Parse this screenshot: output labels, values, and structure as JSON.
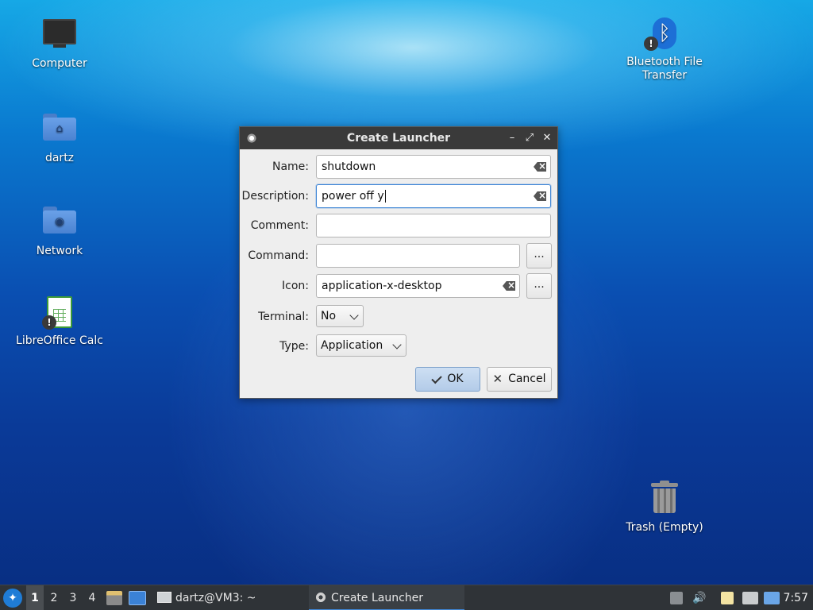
{
  "desktop": {
    "icons": [
      {
        "label": "Computer",
        "icon": "computer-icon"
      },
      {
        "label": "dartz",
        "icon": "home-folder-icon"
      },
      {
        "label": "Network",
        "icon": "network-folder-icon"
      },
      {
        "label": "LibreOffice Calc",
        "icon": "spreadsheet-icon"
      },
      {
        "label": "Bluetooth File Transfer",
        "icon": "bluetooth-icon"
      },
      {
        "label": "Trash (Empty)",
        "icon": "trash-icon"
      }
    ],
    "home_glyph": "⌂",
    "network_glyph": "◉",
    "warn_glyph": "!",
    "bluetooth_glyph": "ᛒ"
  },
  "dialog": {
    "title": "Create Launcher",
    "controls": {
      "minimize": "–",
      "maximize": "⤢",
      "close": "✕"
    },
    "labels": {
      "name": "Name:",
      "description": "Description:",
      "comment": "Comment:",
      "command": "Command:",
      "icon": "Icon:",
      "terminal": "Terminal:",
      "type": "Type:"
    },
    "values": {
      "name": "shutdown",
      "description": "power off y",
      "comment": "",
      "command": "",
      "icon": "application-x-desktop",
      "terminal": "No",
      "type": "Application"
    },
    "browse_label": "...",
    "ok_label": "OK",
    "cancel_label": "Cancel",
    "cancel_glyph": "✕"
  },
  "taskbar": {
    "start_glyph": "✦",
    "workspaces": [
      "1",
      "2",
      "3",
      "4"
    ],
    "active_workspace": "1",
    "tasks": [
      {
        "label": "dartz@VM3: ~",
        "active": false
      },
      {
        "label": "Create Launcher",
        "active": true
      }
    ],
    "volume_glyph": "🔊",
    "clock": "7:57"
  },
  "colors": {
    "accent": "#3f86d6",
    "titlebar": "#3a3a3a",
    "taskbar": "#2f3337"
  }
}
